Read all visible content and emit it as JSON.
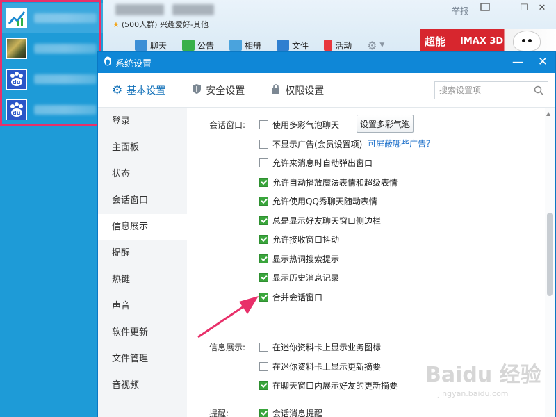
{
  "group_window": {
    "subtitle": "(500人群) 兴趣爱好-其他",
    "report": "举报",
    "tabs": [
      "聊天",
      "公告",
      "相册",
      "文件",
      "活动"
    ],
    "ad_left": "超能",
    "ad_mid": "IMAX 3D"
  },
  "settings": {
    "title": "系统设置",
    "tabs": [
      "基本设置",
      "安全设置",
      "权限设置"
    ],
    "search_placeholder": "搜索设置项",
    "nav": [
      "登录",
      "主面板",
      "状态",
      "会话窗口",
      "信息展示",
      "提醒",
      "热键",
      "声音",
      "软件更新",
      "文件管理",
      "音视频"
    ],
    "active_nav": "信息展示",
    "sections": {
      "session": {
        "label": "会话窗口:",
        "button": "设置多彩气泡",
        "ad_link": "可屏蔽哪些广告？",
        "options": [
          {
            "label": "使用多彩气泡聊天",
            "checked": false
          },
          {
            "label": "不显示广告(会员设置项)",
            "checked": false
          },
          {
            "label": "允许来消息时自动弹出窗口",
            "checked": false
          },
          {
            "label": "允许自动播放魔法表情和超级表情",
            "checked": true
          },
          {
            "label": "允许使用QQ秀聊天随动表情",
            "checked": true
          },
          {
            "label": "总是显示好友聊天窗口侧边栏",
            "checked": true
          },
          {
            "label": "允许接收窗口抖动",
            "checked": true
          },
          {
            "label": "显示热词搜索提示",
            "checked": true
          },
          {
            "label": "显示历史消息记录",
            "checked": true
          },
          {
            "label": "合并会话窗口",
            "checked": true
          }
        ]
      },
      "info": {
        "label": "信息展示:",
        "options": [
          {
            "label": "在迷你资料卡上显示业务图标",
            "checked": false
          },
          {
            "label": "在迷你资料卡上显示更新摘要",
            "checked": false
          },
          {
            "label": "在聊天窗口内展示好友的更新摘要",
            "checked": true
          }
        ]
      },
      "remind": {
        "label": "提醒:",
        "options": [
          {
            "label": "会话消息提醒",
            "checked": true
          }
        ]
      }
    }
  },
  "watermark": {
    "main": "Baidu 经验",
    "sub": "jingyan.baidu.com"
  },
  "colors": {
    "accent": "#0f87d7",
    "highlight": "#e8306a",
    "check": "#3aa53c"
  }
}
